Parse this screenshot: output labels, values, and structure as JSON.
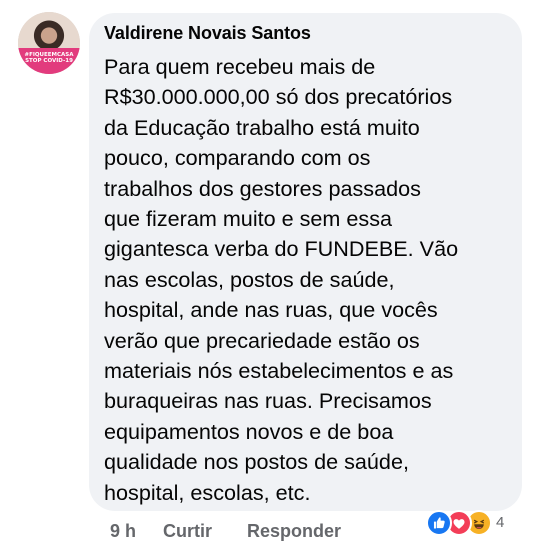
{
  "comment": {
    "author": "Valdirene Novais Santos",
    "avatar_frame": {
      "line1": "#FIQUEEMCASA",
      "line2": "STOP COVID-19"
    },
    "text_lines": [
      "Para quem recebeu mais de",
      "R$30.000.000,00  só dos precatórios",
      "da Educação trabalho está muito",
      "pouco, comparando com os",
      "trabalhos dos gestores passados",
      "que fizeram muito e sem essa",
      "gigantesca verba do FUNDEBE. Vão",
      "nas escolas, postos de saúde,",
      "hospital, ande nas ruas, que vocês",
      "verão que precariedade estão os",
      "materiais nós estabelecimentos e as",
      "buraqueiras nas ruas. Precisamos",
      "equipamentos novos e de boa",
      "qualidade nos postos de saúde,",
      "hospital, escolas, etc."
    ]
  },
  "actions": {
    "time": "9 h",
    "like_label": "Curtir",
    "reply_label": "Responder"
  },
  "reactions": {
    "icons": [
      "like-icon",
      "love-icon",
      "haha-icon"
    ],
    "count": "4",
    "colors": {
      "like": "#1877f2",
      "love": "#f33e58",
      "haha": "#f7b125"
    }
  }
}
